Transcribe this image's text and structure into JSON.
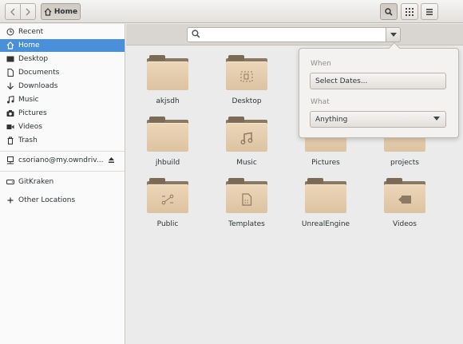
{
  "header": {
    "back_icon": "go-previous-icon",
    "forward_icon": "go-next-icon",
    "path_label": "Home",
    "path_icon": "home-icon",
    "search_icon": "search-icon",
    "view_icon": "grid-view-icon",
    "menu_icon": "menu-icon"
  },
  "sidebar": {
    "items": [
      {
        "label": "Recent",
        "icon": "clock-icon",
        "glyph": "🕘"
      },
      {
        "label": "Home",
        "icon": "home-icon",
        "glyph": "⌂"
      },
      {
        "label": "Desktop",
        "icon": "desktop-icon",
        "glyph": "▬"
      },
      {
        "label": "Documents",
        "icon": "document-icon",
        "glyph": "▯"
      },
      {
        "label": "Downloads",
        "icon": "download-icon",
        "glyph": "↓"
      },
      {
        "label": "Music",
        "icon": "music-icon",
        "glyph": "♫"
      },
      {
        "label": "Pictures",
        "icon": "camera-icon",
        "glyph": "◙"
      },
      {
        "label": "Videos",
        "icon": "video-icon",
        "glyph": "▶"
      },
      {
        "label": "Trash",
        "icon": "trash-icon",
        "glyph": "🗑"
      }
    ],
    "mounts": [
      {
        "label": "csoriano@my.owndriv...",
        "icon": "network-drive-icon",
        "glyph": "⊟",
        "eject_icon": "eject-icon"
      }
    ],
    "extra": [
      {
        "label": "GitKraken",
        "icon": "drive-icon",
        "glyph": "▭"
      },
      {
        "label": "Other Locations",
        "icon": "plus-icon",
        "glyph": "+"
      }
    ]
  },
  "search": {
    "placeholder": "",
    "value": "",
    "dropdown_icon": "chevron-down-icon"
  },
  "files": [
    {
      "name": "akjsdh",
      "emblem": ""
    },
    {
      "name": "Desktop",
      "emblem": "⬚"
    },
    {
      "name": "",
      "emblem": ""
    },
    {
      "name": "",
      "emblem": ""
    },
    {
      "name": "jhbuild",
      "emblem": ""
    },
    {
      "name": "Music",
      "emblem": "♫"
    },
    {
      "name": "Pictures",
      "emblem": "◉"
    },
    {
      "name": "projects",
      "emblem": ""
    },
    {
      "name": "Public",
      "emblem": "⤢"
    },
    {
      "name": "Templates",
      "emblem": "▤"
    },
    {
      "name": "UnrealEngine",
      "emblem": ""
    },
    {
      "name": "Videos",
      "emblem": "■◀"
    }
  ],
  "popover": {
    "when_label": "When",
    "dates_button": "Select Dates...",
    "what_label": "What",
    "what_value": "Anything"
  }
}
